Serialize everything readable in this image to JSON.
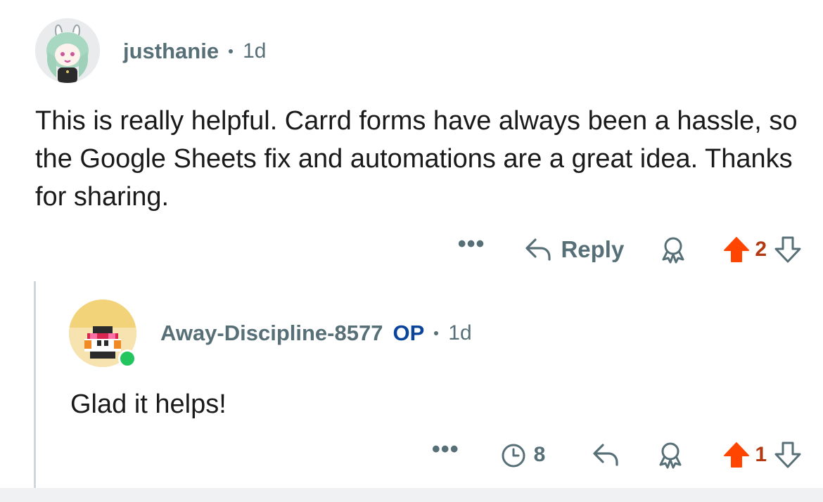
{
  "comment": {
    "author": "justhanie",
    "age": "1d",
    "body": "This is really helpful. Carrd forms have always been a hassle, so the Google Sheets fix and automations are a great idea. Thanks for sharing.",
    "actions": {
      "more": "•••",
      "reply_label": "Reply",
      "score": "2"
    }
  },
  "reply": {
    "author": "Away-Discipline-8577",
    "op_label": "OP",
    "age": "1d",
    "body": "Glad it helps!",
    "actions": {
      "more": "•••",
      "timer_count": "8",
      "score": "1"
    }
  },
  "icons": {
    "reply": "reply-arrow-icon",
    "award": "award-icon",
    "upvote": "upvote-arrow-icon",
    "downvote": "downvote-arrow-icon",
    "timer": "timer-icon",
    "more": "more-options-icon"
  },
  "colors": {
    "upvote_active": "#ff4500",
    "score_active": "#b33a13",
    "meta_text": "#576f76",
    "op_badge": "#0a449b",
    "online": "#22c55e"
  }
}
